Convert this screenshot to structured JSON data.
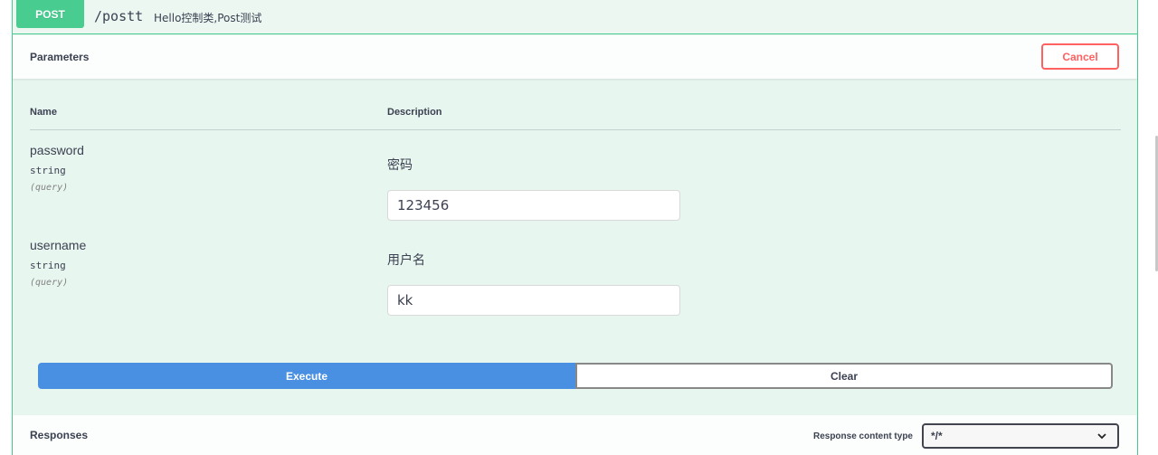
{
  "operation": {
    "method": "POST",
    "path": "/postt",
    "summary": "Hello控制类,Post测试"
  },
  "parameters_section": {
    "title": "Parameters",
    "cancel_label": "Cancel",
    "columns": {
      "name": "Name",
      "description": "Description"
    },
    "params": [
      {
        "name": "password",
        "type": "string",
        "in": "(query)",
        "description": "密码",
        "value": "123456"
      },
      {
        "name": "username",
        "type": "string",
        "in": "(query)",
        "description": "用户名",
        "value": "kk"
      }
    ]
  },
  "actions": {
    "execute_label": "Execute",
    "clear_label": "Clear"
  },
  "responses_section": {
    "title": "Responses",
    "content_type_label": "Response content type",
    "content_type_value": "*/*"
  },
  "colors": {
    "post_accent": "#49cc90",
    "execute_blue": "#4990e2",
    "cancel_red": "#ff6060"
  }
}
